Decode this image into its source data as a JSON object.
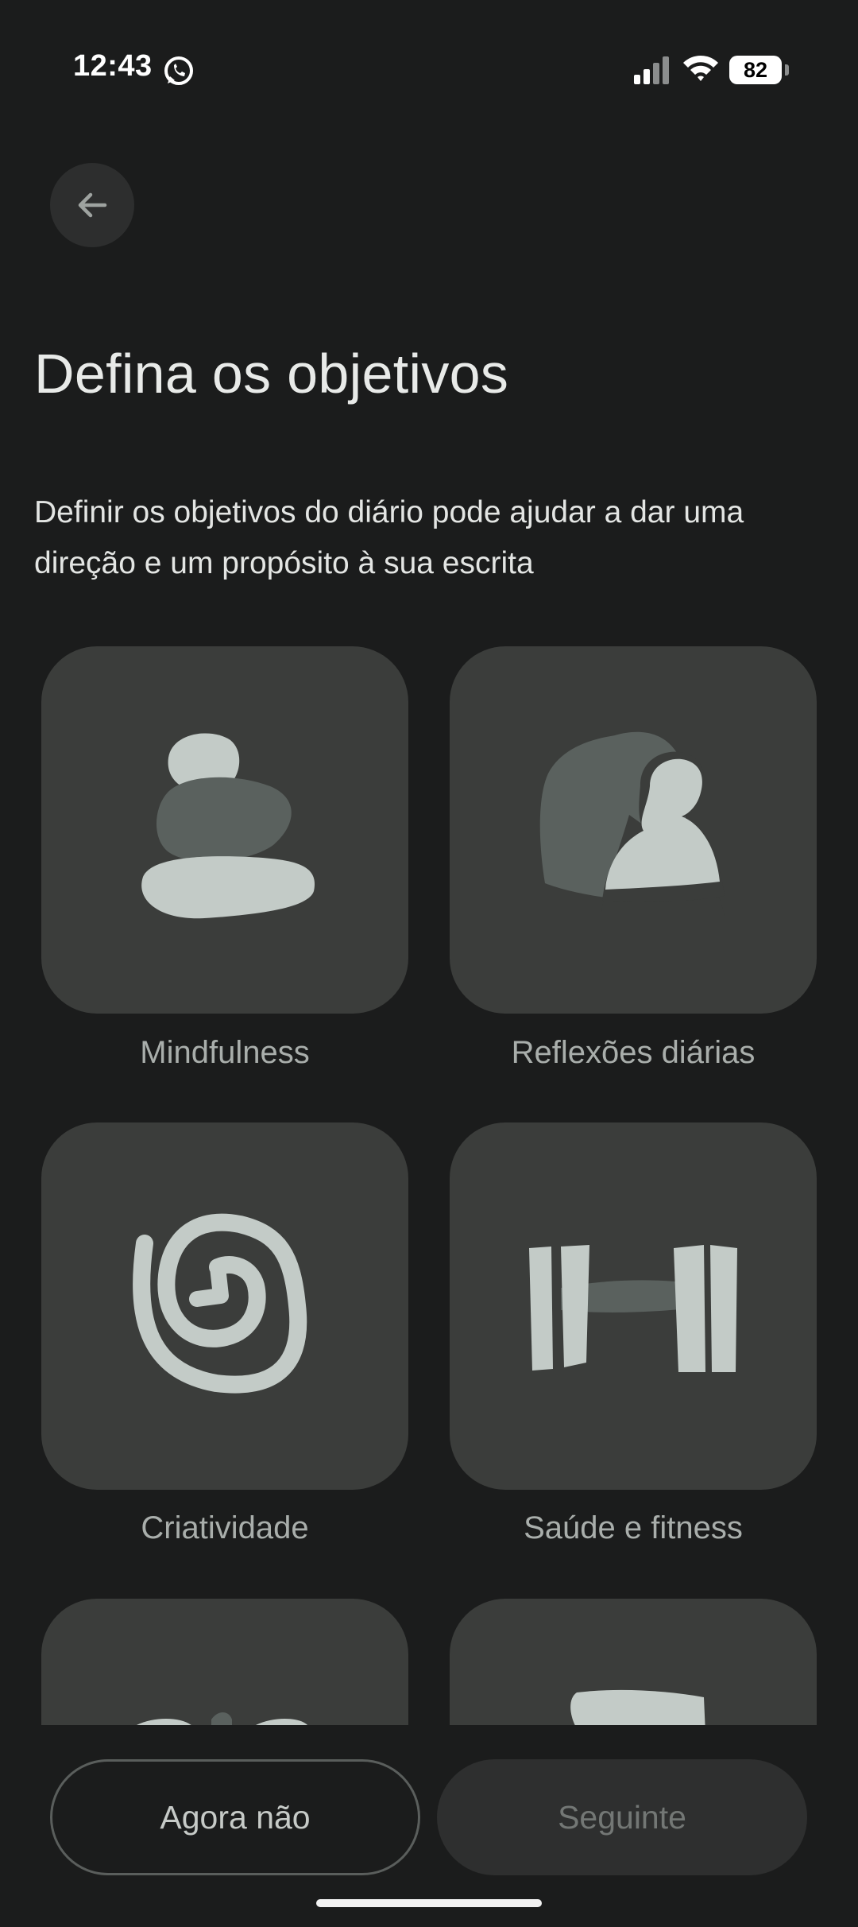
{
  "status_bar": {
    "time": "12:43",
    "battery_level": "82",
    "icons": [
      "whatsapp-icon",
      "signal-icon",
      "wifi-icon",
      "battery-icon"
    ]
  },
  "header": {
    "back_icon": "arrow-back-icon",
    "title": "Defina os objetivos",
    "subtitle": "Definir os objetivos do diário pode ajudar a dar uma direção e um propósito à sua escrita"
  },
  "goals": [
    {
      "label": "Mindfulness",
      "icon": "stacked-stones-icon"
    },
    {
      "label": "Reflexões diárias",
      "icon": "person-silhouette-icon"
    },
    {
      "label": "Criatividade",
      "icon": "spiral-icon"
    },
    {
      "label": "Saúde e fitness",
      "icon": "dumbbell-icon"
    },
    {
      "label": "",
      "icon": "partial-goal-icon"
    },
    {
      "label": "",
      "icon": "partial-goal-icon"
    }
  ],
  "buttons": {
    "skip_label": "Agora não",
    "next_label": "Seguinte"
  },
  "colors": {
    "background": "#1b1c1c",
    "card": "#3b3d3b",
    "icon_light": "#c3cbc7",
    "icon_dark": "#5a615e"
  }
}
